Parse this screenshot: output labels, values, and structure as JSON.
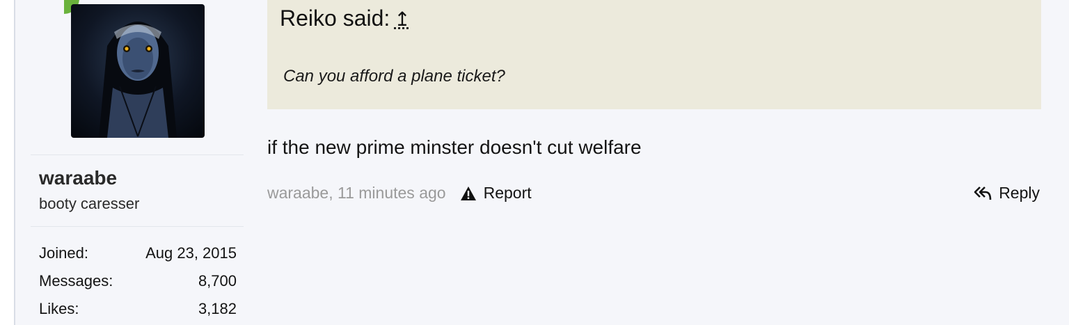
{
  "user": {
    "name": "waraabe",
    "title": "booty caresser",
    "avatar_icon": "nun-avatar",
    "online_indicator_color": "#6ab23c",
    "stats": [
      {
        "label": "Joined:",
        "value": "Aug 23, 2015"
      },
      {
        "label": "Messages:",
        "value": "8,700"
      },
      {
        "label": "Likes:",
        "value": "3,182"
      }
    ]
  },
  "quote": {
    "author": "Reiko said:",
    "jump_icon": "up-arrow-icon",
    "text": "Can you afford a plane ticket?",
    "background": "#eceadc"
  },
  "post": {
    "message": "if the new prime minster doesn't cut welfare",
    "meta": "waraabe, 11 minutes ago",
    "report_label": "Report",
    "reply_label": "Reply"
  }
}
